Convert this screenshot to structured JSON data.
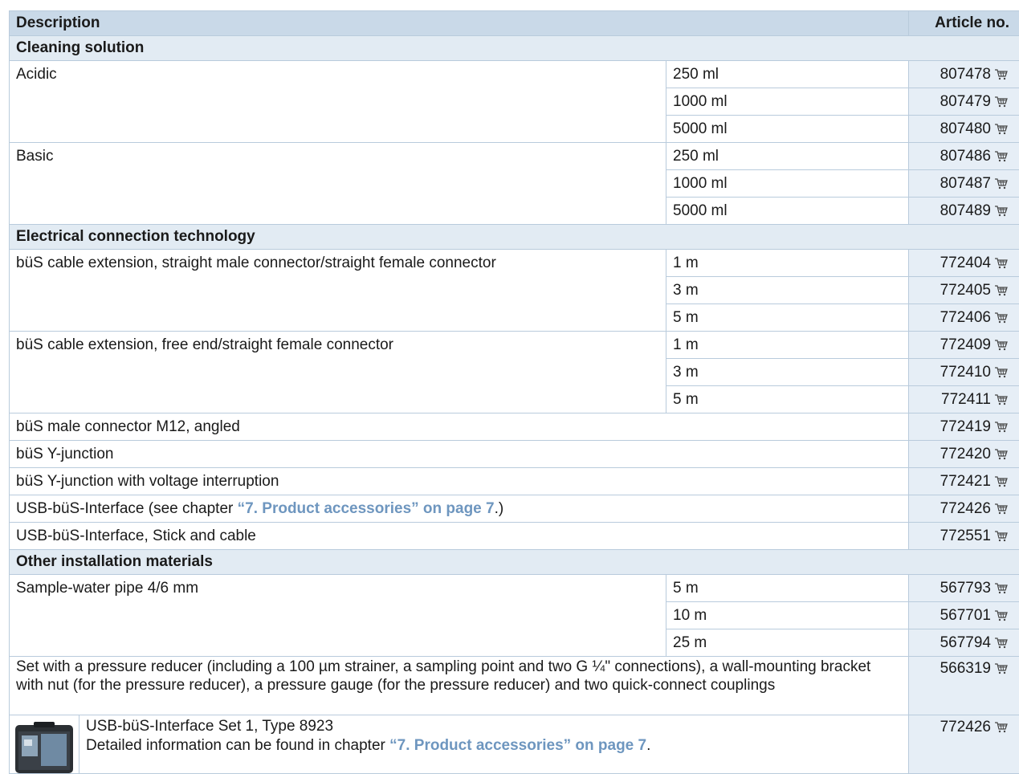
{
  "header": {
    "description": "Description",
    "article_no": "Article no."
  },
  "sections": [
    {
      "title": "Cleaning solution",
      "groups": [
        {
          "desc": "Acidic",
          "items": [
            {
              "size": "250 ml",
              "art": "807478"
            },
            {
              "size": "1000 ml",
              "art": "807479"
            },
            {
              "size": "5000 ml",
              "art": "807480"
            }
          ]
        },
        {
          "desc": "Basic",
          "items": [
            {
              "size": "250 ml",
              "art": "807486"
            },
            {
              "size": "1000 ml",
              "art": "807487"
            },
            {
              "size": "5000 ml",
              "art": "807489"
            }
          ]
        }
      ]
    },
    {
      "title": "Electrical connection technology",
      "groups": [
        {
          "desc": "büS cable extension, straight male connector/straight female connector",
          "items": [
            {
              "size": "1 m",
              "art": "772404"
            },
            {
              "size": "3 m",
              "art": "772405"
            },
            {
              "size": "5 m",
              "art": "772406"
            }
          ]
        },
        {
          "desc": "büS cable extension, free end/straight female connector",
          "items": [
            {
              "size": "1 m",
              "art": "772409"
            },
            {
              "size": "3 m",
              "art": "772410"
            },
            {
              "size": "5 m",
              "art": "772411"
            }
          ]
        }
      ],
      "singles": [
        {
          "desc": "büS male connector M12, angled",
          "art": "772419"
        },
        {
          "desc": "büS Y-junction",
          "art": "772420"
        },
        {
          "desc": "büS Y-junction with voltage interruption",
          "art": "772421"
        },
        {
          "desc_before": "USB-büS-Interface (see chapter ",
          "link": "“7. Product accessories” on page 7",
          "desc_after": ".)",
          "art": "772426"
        },
        {
          "desc": "USB-büS-Interface, Stick and cable",
          "art": "772551"
        }
      ]
    },
    {
      "title": "Other installation materials",
      "groups": [
        {
          "desc": "Sample-water pipe 4/6 mm",
          "items": [
            {
              "size": "5 m",
              "art": "567793"
            },
            {
              "size": "10 m",
              "art": "567701"
            },
            {
              "size": "25 m",
              "art": "567794"
            }
          ]
        }
      ],
      "set_reducer": {
        "desc": "Set with a pressure reducer (including a 100 µm strainer, a sampling point and two G ¼\" connections), a wall-mounting bracket with nut (for the pressure reducer), a pressure gauge (for the pressure reducer) and two quick-connect couplings",
        "art": "566319"
      },
      "set_usb": {
        "line1": "USB-büS-Interface Set 1, Type 8923",
        "line2_before": "Detailed information can be found in chapter ",
        "link": "“7. Product accessories” on page 7",
        "line2_after": ".",
        "art": "772426"
      }
    }
  ],
  "icons": {
    "cart": "shopping-cart-icon",
    "thumbnail": "product-case-image"
  },
  "colors": {
    "header_bg": "#c9d9e8",
    "section_bg": "#e2ebf3",
    "article_bg": "#e6eef6",
    "link": "#6e96bf",
    "border": "#b9cbdc"
  }
}
